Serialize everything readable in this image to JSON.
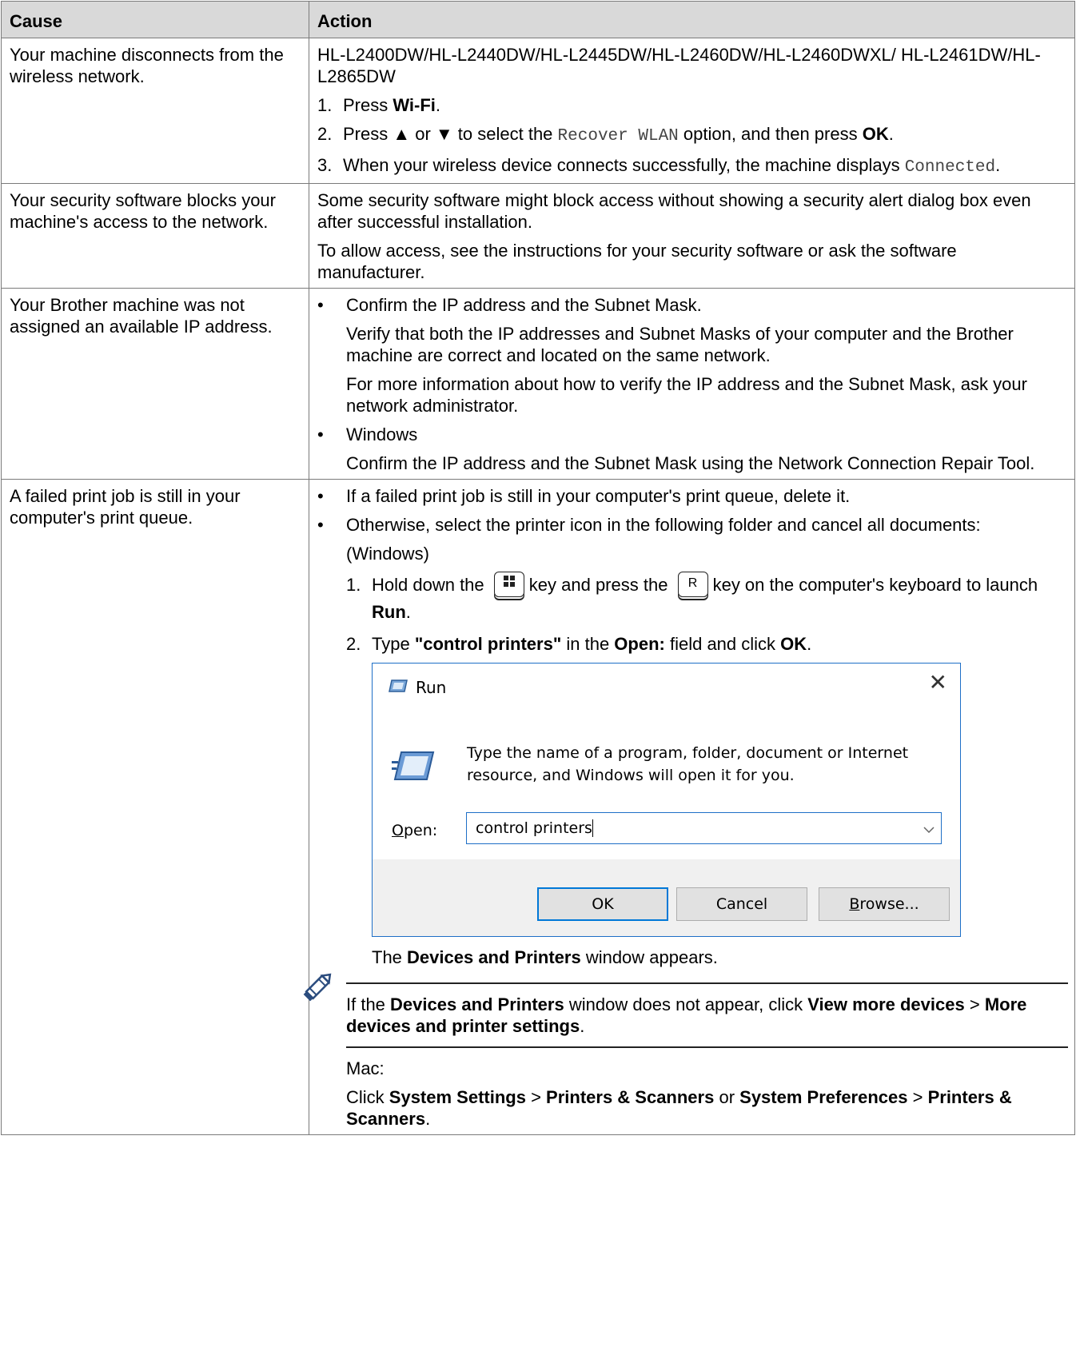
{
  "table": {
    "headers": {
      "cause": "Cause",
      "action": "Action"
    },
    "row1": {
      "cause": "Your machine disconnects from the wireless network.",
      "models": "HL-L2400DW/HL-L2440DW/HL-L2445DW/HL-L2460DW/HL-L2460DWXL/ HL-L2461DW/HL-L2865DW",
      "step1": {
        "num": "1.",
        "pre": "Press ",
        "bold": "Wi-Fi",
        "post": "."
      },
      "step2": {
        "num": "2.",
        "pre": "Press ▲ or ▼ to select the ",
        "mono": "Recover WLAN",
        "mid": " option, and then press ",
        "bold": "OK",
        "post": "."
      },
      "step3": {
        "num": "3.",
        "pre": "When your wireless device connects successfully, the machine displays ",
        "mono": "Connected",
        "post": "."
      }
    },
    "row2": {
      "cause": "Your security software blocks your machine's access to the network.",
      "p1": "Some security software might block access without showing a security alert dialog box even after successful installation.",
      "p2": "To allow access, see the instructions for your security software or ask the software manufacturer."
    },
    "row3": {
      "cause": "Your Brother machine was not assigned an available IP address.",
      "bullet": "•",
      "b1_title": "Confirm the IP address and the Subnet Mask.",
      "b1_p1": "Verify that both the IP addresses and Subnet Masks of your computer and the Brother machine are correct and located on the same network.",
      "b1_p2": "For more information about how to verify the IP address and the Subnet Mask, ask your network administrator.",
      "b2_title": "Windows",
      "b2_p1": "Confirm the IP address and the Subnet Mask using the Network Connection Repair Tool."
    },
    "row4": {
      "cause": "A failed print job is still in your computer's print queue.",
      "b1": "If a failed print job is still in your computer's print queue, delete it.",
      "b2": "Otherwise, select the printer icon in the following folder and cancel all documents:",
      "windows_label": "(Windows)",
      "step1": {
        "num": "1.",
        "pre": "Hold down the",
        "mid": "key and press the",
        "key2": "R",
        "post": "key on the computer's keyboard to launch ",
        "bold": "Run",
        "end": "."
      },
      "step2": {
        "num": "2.",
        "pre": "Type ",
        "bold1": "\"control printers\"",
        "mid1": " in the ",
        "bold2": "Open:",
        "mid2": " field and click ",
        "bold3": "OK",
        "end": "."
      },
      "dialog": {
        "title": "Run",
        "close": "✕",
        "description": "Type the name of a program, folder, document or Internet resource, and Windows will open it for you.",
        "open_label_u": "O",
        "open_label_rest": "pen:",
        "input_value": "control printers",
        "ok": "OK",
        "cancel": "Cancel",
        "browse_u": "B",
        "browse_rest": "rowse..."
      },
      "appears": {
        "pre": "The ",
        "bold": "Devices and Printers",
        "post": " window appears."
      },
      "note": {
        "pre": "If the ",
        "bold1": "Devices and Printers",
        "mid1": " window does not appear, click ",
        "bold2": "View more devices",
        "mid2": " > ",
        "bold3": "More devices and printer settings",
        "end": "."
      },
      "mac_label": "Mac:",
      "mac": {
        "pre": "Click ",
        "bold1": "System Settings",
        "mid1": " > ",
        "bold2": "Printers & Scanners",
        "mid2": " or ",
        "bold3": "System Preferences",
        "mid3": " > ",
        "bold4": "Printers & Scanners",
        "end": "."
      }
    }
  }
}
